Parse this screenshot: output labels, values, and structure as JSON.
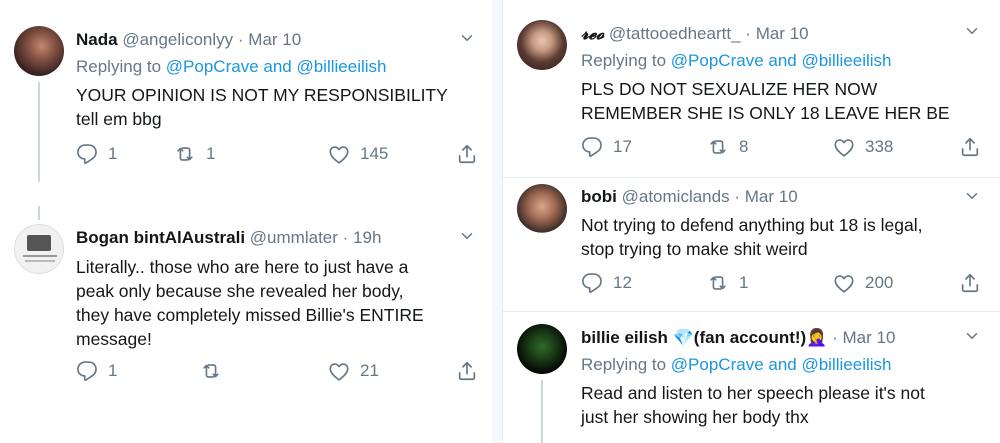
{
  "left": {
    "tweets": [
      {
        "name": "Nada",
        "handle": "@angeliconlyy",
        "dot": "·",
        "time": "Mar 10",
        "replying_prefix": "Replying to",
        "replying_users": "@PopCrave and @billieeilish",
        "lines": [
          "YOUR OPINION IS NOT MY RESPONSIBILITY",
          "tell em bbg"
        ],
        "replies": "1",
        "retweets": "1",
        "likes": "145"
      },
      {
        "name": "Bogan bintAlAustrali",
        "handle": "@ummlater",
        "dot": "·",
        "time": "19h",
        "lines": [
          "Literally.. those who are here to just have a",
          "peak only because she revealed her body,",
          "they have completely missed Billie's ENTIRE",
          "message!"
        ],
        "replies": "1",
        "retweets": "",
        "likes": "21"
      }
    ]
  },
  "right": {
    "tweets": [
      {
        "name": "𝓻𝓮𝓸",
        "handle": "@tattooedheartt_",
        "dot": "·",
        "time": "Mar 10",
        "replying_prefix": "Replying to",
        "replying_users": "@PopCrave and @billieeilish",
        "lines": [
          "PLS DO NOT SEXUALIZE HER NOW",
          "REMEMBER SHE IS ONLY 18 LEAVE HER BE"
        ],
        "replies": "17",
        "retweets": "8",
        "likes": "338"
      },
      {
        "name": "bobi",
        "handle": "@atomiclands",
        "dot": "·",
        "time": "Mar 10",
        "lines": [
          "Not trying to defend anything but 18 is legal,",
          "stop trying to make shit weird"
        ],
        "replies": "12",
        "retweets": "1",
        "likes": "200"
      },
      {
        "name": "billie eilish 💎(fan account!)🤦‍♀️",
        "dot": "·",
        "time": "Mar 10",
        "replying_prefix": "Replying to",
        "replying_users": "@PopCrave and @billieeilish",
        "lines": [
          "Read and listen to her speech please it's not",
          "just her showing her body thx"
        ]
      }
    ]
  },
  "icons": {
    "reply": "reply-icon",
    "retweet": "retweet-icon",
    "like": "heart-icon",
    "share": "share-icon",
    "more": "chevron-down-icon"
  },
  "colors": {
    "link": "#1b95e0",
    "muted": "#657786",
    "text": "#14171a",
    "divider": "#e6ecf0"
  }
}
